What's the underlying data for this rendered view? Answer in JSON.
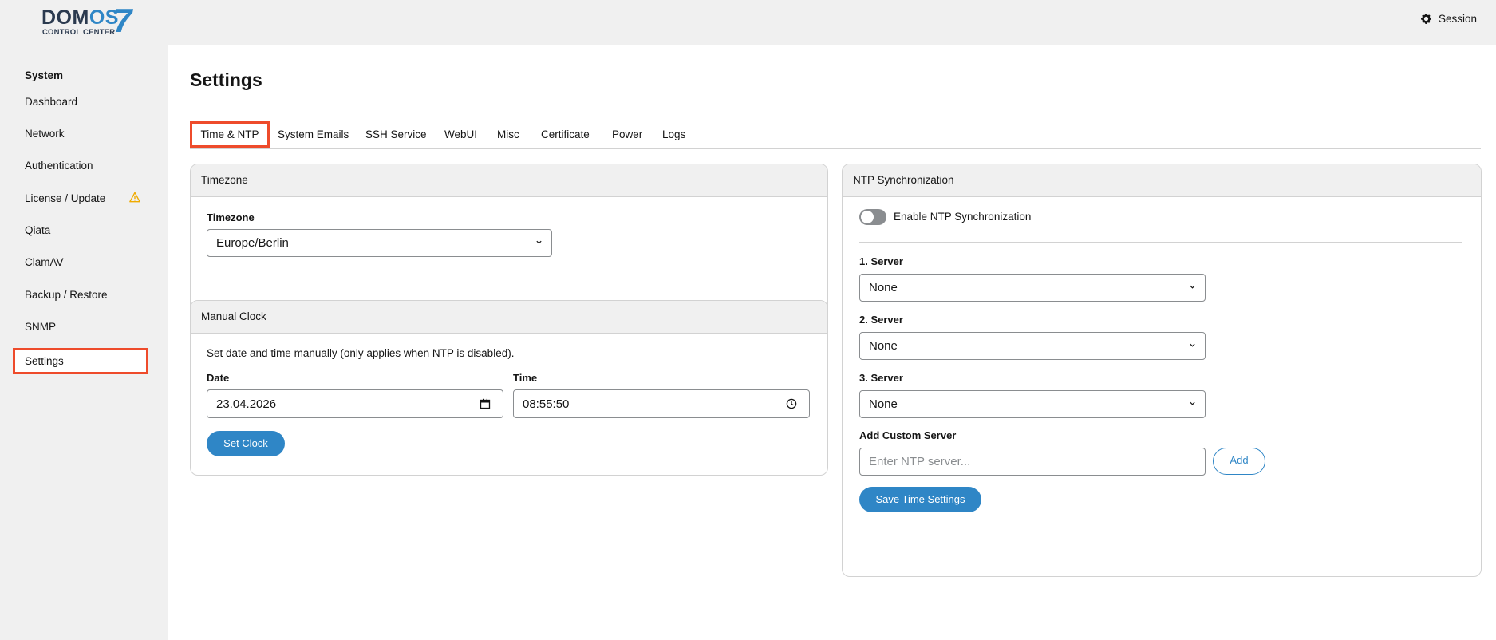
{
  "app": {
    "logo_brand_prefix": "DOM",
    "logo_brand_os": "OS",
    "logo_number": "7",
    "logo_subtitle": "CONTROL CENTER",
    "session_label": "Session",
    "session_icon": "gear-icon"
  },
  "sidebar": {
    "heading": "System",
    "items": [
      {
        "label": "Dashboard"
      },
      {
        "label": "Network"
      },
      {
        "label": "Authentication"
      },
      {
        "label": "License / Update",
        "icon": "warning-icon"
      },
      {
        "label": "Qiata"
      },
      {
        "label": "ClamAV"
      },
      {
        "label": "Backup / Restore"
      },
      {
        "label": "SNMP"
      },
      {
        "label": "Settings",
        "active": true
      }
    ]
  },
  "page": {
    "title": "Settings"
  },
  "tabs": [
    {
      "label": "Time & NTP",
      "active": true
    },
    {
      "label": "System Emails"
    },
    {
      "label": "SSH Service"
    },
    {
      "label": "WebUI"
    },
    {
      "label": "Misc"
    },
    {
      "label": "Certificate"
    },
    {
      "label": "Power"
    },
    {
      "label": "Logs"
    }
  ],
  "timezone_panel": {
    "header": "Timezone",
    "field_label": "Timezone",
    "selected": "Europe/Berlin"
  },
  "manual_clock_panel": {
    "header": "Manual Clock",
    "description": "Set date and time manually (only applies when NTP is disabled).",
    "date_label": "Date",
    "date_value": "23.04.2026",
    "time_label": "Time",
    "time_value": "08:55:50",
    "set_button": "Set Clock"
  },
  "ntp_panel": {
    "header": "NTP Synchronization",
    "toggle_label": "Enable NTP Synchronization",
    "toggle_enabled": false,
    "servers": [
      {
        "label": "1. Server",
        "value": "None"
      },
      {
        "label": "2. Server",
        "value": "None"
      },
      {
        "label": "3. Server",
        "value": "None"
      }
    ],
    "custom_label": "Add Custom Server",
    "custom_placeholder": "Enter NTP server...",
    "add_button": "Add",
    "save_button": "Save Time Settings"
  },
  "colors": {
    "accent": "#2f86c6",
    "highlight": "#ee4b2b",
    "warning": "#f0ab00"
  }
}
